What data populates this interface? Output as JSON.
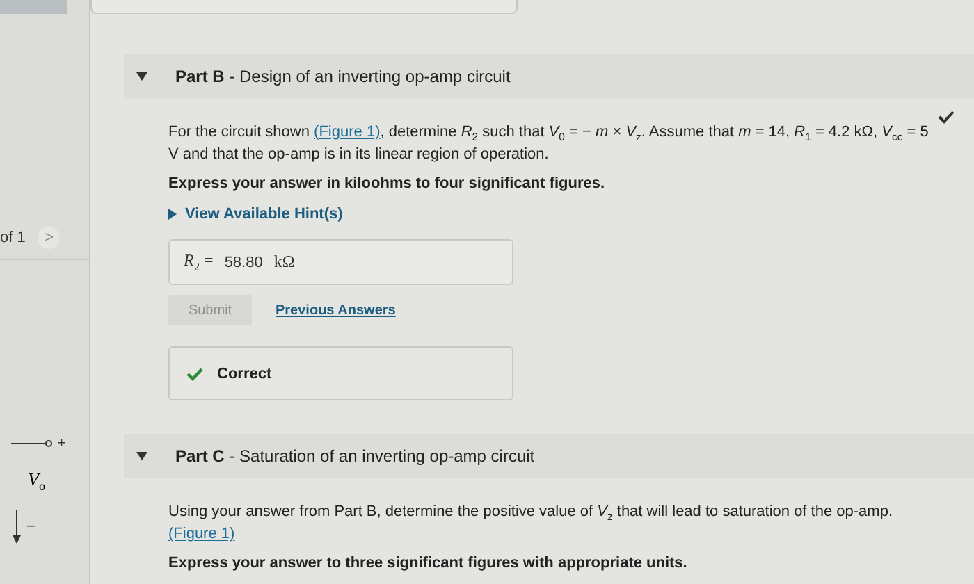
{
  "sidebar": {
    "pager_text": "of 1",
    "next": ">",
    "circuit": {
      "plus": "+",
      "label": "*V*$_{o}$",
      "minus": "−"
    }
  },
  "parts": [
    {
      "title_bold": "Part B",
      "title": "- Design of an inverting op-amp circuit",
      "expanded": true,
      "completed": true,
      "problem": [
        {
          "kind": "text",
          "text": "For the circuit shown "
        },
        {
          "kind": "link",
          "text": "(Figure 1)"
        },
        {
          "kind": "text",
          "text": ", determine *R*$_{2}$ such that *V*$_{0}$ = − *m* × *V*$_{z}$. Assume that *m* = 14, *R*$_{1}$ = 4.2 kΩ, *V*$_{cc}$ = 5 V and that the op-amp is in its linear region of operation."
        }
      ],
      "instruction": "Express your answer in kiloohms to four significant figures.",
      "hint": "View Available Hint(s)",
      "answer": {
        "label": "*R*$_{2}$ =",
        "value": "58.80",
        "unit": "kΩ"
      },
      "submit": {
        "label": "Submit",
        "disabled": true
      },
      "previous": "Previous Answers",
      "feedback": {
        "text": "Correct",
        "correct": true
      }
    },
    {
      "title_bold": "Part C",
      "title": "- Saturation of an inverting op-amp circuit",
      "expanded": true,
      "completed": false,
      "problem": [
        {
          "kind": "text",
          "text": "Using your answer from Part B, determine the positive value of *V*$_{z}$ that will lead to saturation of the op-amp."
        },
        {
          "kind": "link",
          "text": "(Figure 1)"
        }
      ],
      "instruction": "Express your answer to three significant figures with appropriate units."
    }
  ]
}
